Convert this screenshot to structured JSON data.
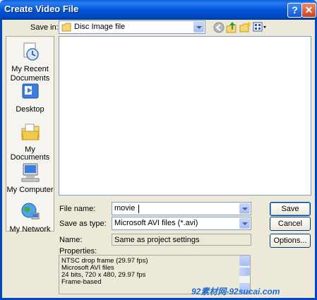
{
  "window": {
    "title": "Create Video File",
    "help_glyph": "?",
    "close_glyph": "✕"
  },
  "save_in": {
    "label": "Save in:",
    "value": "Disc Image file",
    "toolbar_icons": [
      "back-icon",
      "up-folder-icon",
      "new-folder-icon",
      "views-menu-icon"
    ]
  },
  "places": [
    {
      "id": "recent",
      "label_line1": "My Recent",
      "label_line2": "Documents",
      "icon": "recent-documents-icon"
    },
    {
      "id": "desktop",
      "label_line1": "Desktop",
      "label_line2": "",
      "icon": "desktop-icon"
    },
    {
      "id": "documents",
      "label_line1": "My Documents",
      "label_line2": "",
      "icon": "my-documents-icon"
    },
    {
      "id": "computer",
      "label_line1": "My Computer",
      "label_line2": "",
      "icon": "my-computer-icon"
    },
    {
      "id": "network",
      "label_line1": "My Network",
      "label_line2": "",
      "icon": "my-network-icon"
    }
  ],
  "file_name": {
    "label": "File name:",
    "value": "movie"
  },
  "save_as_type": {
    "label": "Save as type:",
    "value": "Microsoft AVI files (*.avi)"
  },
  "name": {
    "label": "Name:",
    "value": "Same as project settings"
  },
  "properties": {
    "label": "Properties:",
    "lines": [
      "NTSC drop frame (29.97 fps)",
      "Microsoft AVI files",
      "24 bits, 720 x 480, 29.97 fps",
      "Frame-based"
    ]
  },
  "buttons": {
    "save": "Save",
    "cancel": "Cancel",
    "options": "Options..."
  },
  "watermark": "92素材网-92sucai.com",
  "colors": {
    "titlebar": "#0054E3",
    "dialog_bg": "#ECE9D8",
    "field_border": "#7F9DB9"
  }
}
